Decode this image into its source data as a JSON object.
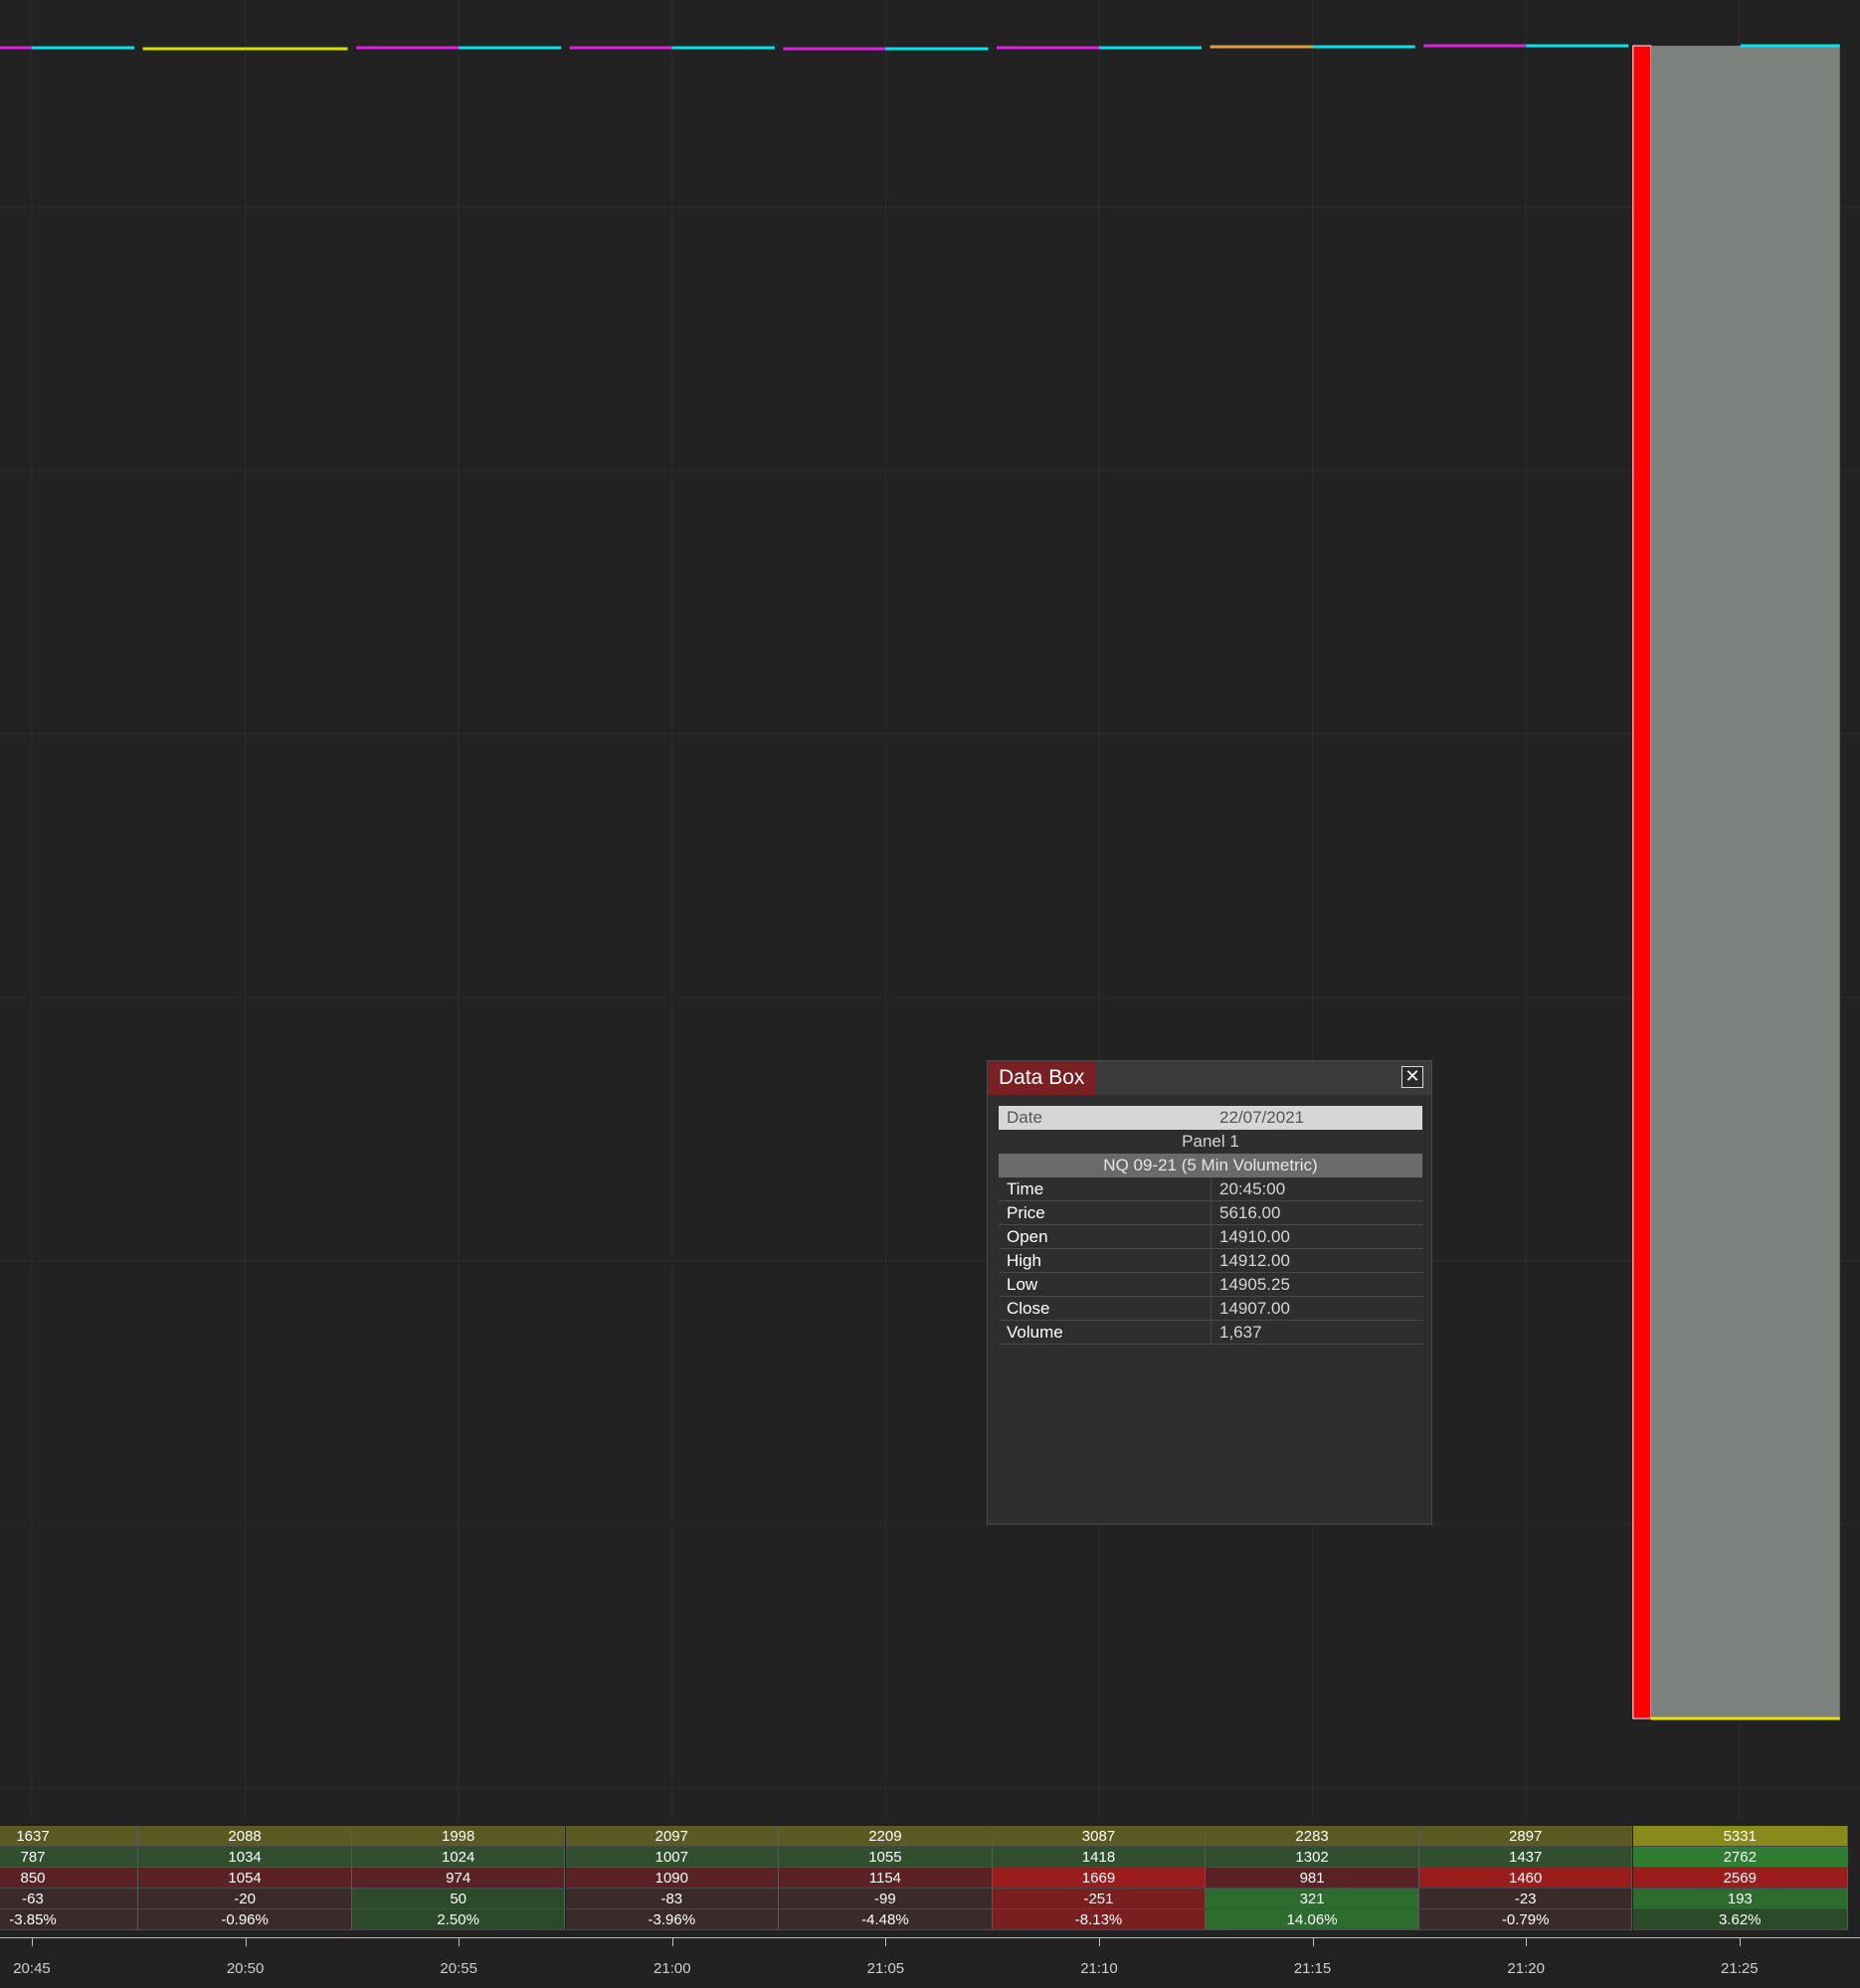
{
  "data_box": {
    "title": "Data Box",
    "close_glyph": "✕",
    "date_label": "Date",
    "date_value": "22/07/2021",
    "panel_label": "Panel 1",
    "series_label": "NQ 09-21 (5 Min Volumetric)",
    "rows": [
      {
        "key": "Time",
        "value": "20:45:00"
      },
      {
        "key": "Price",
        "value": "5616.00"
      },
      {
        "key": "Open",
        "value": "14910.00"
      },
      {
        "key": "High",
        "value": "14912.00"
      },
      {
        "key": "Low",
        "value": "14905.25"
      },
      {
        "key": "Close",
        "value": "14907.00"
      },
      {
        "key": "Volume",
        "value": "1,637"
      }
    ]
  },
  "time_axis": {
    "labels": [
      "20:45",
      "20:50",
      "20:55",
      "21:00",
      "21:05",
      "21:10",
      "21:15",
      "21:20",
      "21:25"
    ]
  },
  "stats": {
    "rows": [
      {
        "name": "volume",
        "values": [
          "1637",
          "2088",
          "1998",
          "2097",
          "2209",
          "3087",
          "2283",
          "2897",
          "5331"
        ]
      },
      {
        "name": "buy-volume",
        "values": [
          "787",
          "1034",
          "1024",
          "1007",
          "1055",
          "1418",
          "1302",
          "1437",
          "2762"
        ]
      },
      {
        "name": "sell-volume",
        "values": [
          "850",
          "1054",
          "974",
          "1090",
          "1154",
          "1669",
          "981",
          "1460",
          "2569"
        ]
      },
      {
        "name": "delta",
        "values": [
          "-63",
          "-20",
          "50",
          "-83",
          "-99",
          "-251",
          "321",
          "-23",
          "193"
        ]
      },
      {
        "name": "delta-percent",
        "values": [
          "-3.85%",
          "-0.96%",
          "2.50%",
          "-3.96%",
          "-4.48%",
          "-8.13%",
          "14.06%",
          "-0.79%",
          "3.62%"
        ]
      }
    ],
    "colors": {
      "volume": "#5b5a22",
      "volume_highlight": "#8a8a1c",
      "buy": "#2f4f2f",
      "buy_highlight": "#2e7d32",
      "sell": "#5a2224",
      "sell_highlight": "#9b1c1c",
      "neutral": "#3a2a2a",
      "positive": "#2a4a2a",
      "positive_strong": "#2e6b2e",
      "negative_strong": "#7a1f1f"
    }
  },
  "colors": {
    "background": "#222222",
    "grid": "#2e2e2e",
    "big_bar_red": "#ff0000",
    "big_bar_gray": "#7e827e",
    "big_bar_top": "#00e5ee",
    "big_bar_bottom": "#e5e500",
    "line_cyan": "#00e5ee",
    "line_magenta": "#e020e0",
    "line_yellow": "#d4e000"
  }
}
